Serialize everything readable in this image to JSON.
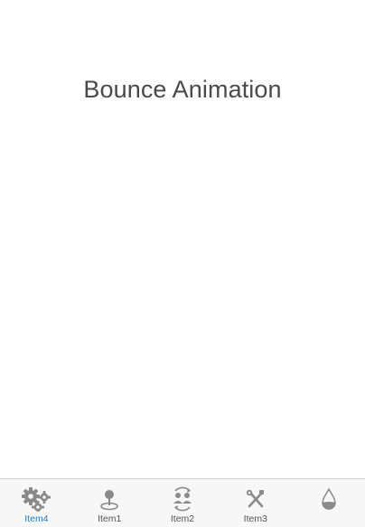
{
  "main": {
    "title": "Bounce Animation"
  },
  "tabbar": {
    "active_index": 0,
    "active_color": "#1a7fd1",
    "inactive_color": "#8a8a8a",
    "items": [
      {
        "label": "Item4",
        "icon": "gears-icon"
      },
      {
        "label": "Item1",
        "icon": "joystick-icon"
      },
      {
        "label": "Item2",
        "icon": "sync-users-icon"
      },
      {
        "label": "Item3",
        "icon": "tools-icon"
      },
      {
        "label": "",
        "icon": "water-drop-icon"
      }
    ]
  }
}
